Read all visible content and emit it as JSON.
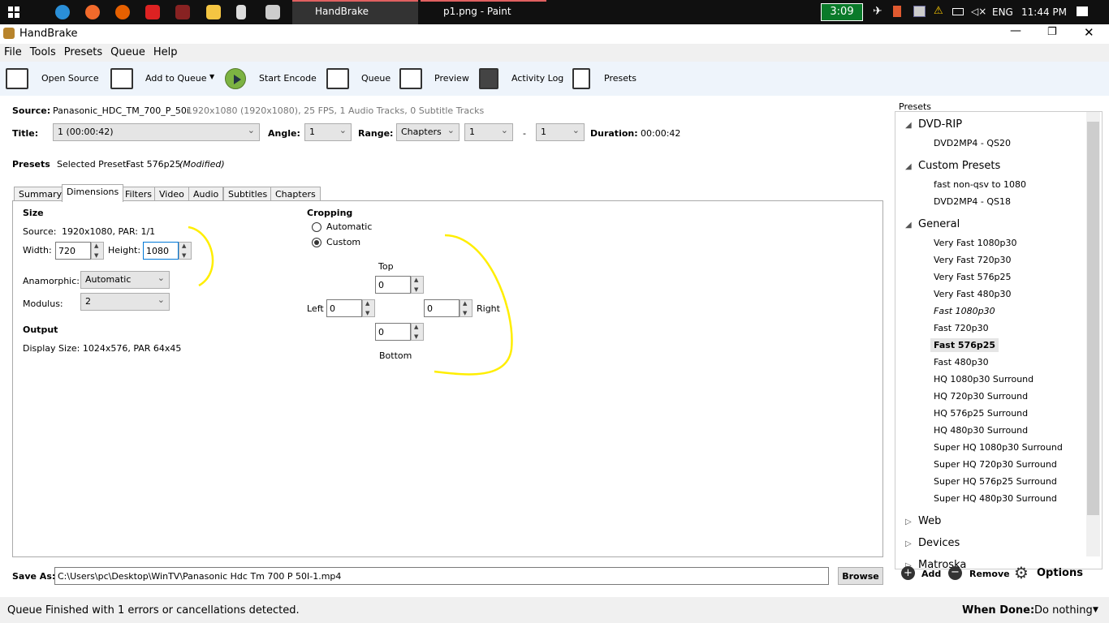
{
  "taskbar": {
    "tasks": [
      "HandBrake",
      "p1.png - Paint"
    ],
    "battery_timer": "3:09",
    "language": "ENG",
    "clock": "11:44 PM"
  },
  "window": {
    "title": "HandBrake"
  },
  "menu": [
    "File",
    "Tools",
    "Presets",
    "Queue",
    "Help"
  ],
  "toolbar": {
    "open_source": "Open Source",
    "add_to_queue": "Add to Queue",
    "start_encode": "Start Encode",
    "queue": "Queue",
    "preview": "Preview",
    "activity_log": "Activity Log",
    "presets": "Presets"
  },
  "source": {
    "label": "Source:",
    "name": "Panasonic_HDC_TM_700_P_50i",
    "info": "1920x1080 (1920x1080), 25 FPS, 1 Audio Tracks, 0 Subtitle Tracks"
  },
  "title_row": {
    "title_label": "Title:",
    "title_value": "1 (00:00:42)",
    "angle_label": "Angle:",
    "angle_value": "1",
    "range_label": "Range:",
    "range_value": "Chapters",
    "range_start": "1",
    "dash": "-",
    "range_end": "1",
    "duration_label": "Duration:",
    "duration_value": "00:00:42"
  },
  "preset_row": {
    "label": "Presets",
    "selected_label": "Selected Preset:",
    "selected_value": "Fast 576p25",
    "modified": "(Modified)"
  },
  "tabs": [
    "Summary",
    "Dimensions",
    "Filters",
    "Video",
    "Audio",
    "Subtitles",
    "Chapters"
  ],
  "dimensions": {
    "size_heading": "Size",
    "source_label": "Source:",
    "source_value": "1920x1080, PAR: 1/1",
    "width_label": "Width:",
    "width_value": "720",
    "height_label": "Height:",
    "height_value": "1080",
    "anamorphic_label": "Anamorphic:",
    "anamorphic_value": "Automatic",
    "modulus_label": "Modulus:",
    "modulus_value": "2",
    "output_heading": "Output",
    "display_size": "Display Size: 1024x576,  PAR 64x45"
  },
  "cropping": {
    "heading": "Cropping",
    "automatic": "Automatic",
    "custom": "Custom",
    "selected": "Custom",
    "top_label": "Top",
    "top": "0",
    "left_label": "Left",
    "left": "0",
    "right_label": "Right",
    "right": "0",
    "bottom_label": "Bottom",
    "bottom": "0"
  },
  "save": {
    "label": "Save As:",
    "path": "C:\\Users\\pc\\Desktop\\WinTV\\Panasonic Hdc Tm 700 P 50I-1.mp4",
    "browse": "Browse"
  },
  "presets_panel": {
    "heading": "Presets",
    "groups": [
      {
        "name": "DVD-RIP",
        "expanded": true,
        "items": [
          "DVD2MP4 - QS20"
        ]
      },
      {
        "name": "Custom Presets",
        "expanded": true,
        "items": [
          "fast non-qsv to 1080",
          "DVD2MP4 - QS18"
        ]
      },
      {
        "name": "General",
        "expanded": true,
        "items": [
          "Very Fast 1080p30",
          "Very Fast 720p30",
          "Very Fast 576p25",
          "Very Fast 480p30",
          "Fast 1080p30",
          "Fast 720p30",
          "Fast 576p25",
          "Fast 480p30",
          "HQ 1080p30 Surround",
          "HQ 720p30 Surround",
          "HQ 576p25 Surround",
          "HQ 480p30 Surround",
          "Super HQ 1080p30 Surround",
          "Super HQ 720p30 Surround",
          "Super HQ 576p25 Surround",
          "Super HQ 480p30 Surround"
        ]
      },
      {
        "name": "Web",
        "expanded": false,
        "items": []
      },
      {
        "name": "Devices",
        "expanded": false,
        "items": []
      },
      {
        "name": "Matroska",
        "expanded": false,
        "items": []
      }
    ],
    "selected": "Fast 576p25",
    "default_italic": "Fast 1080p30",
    "add": "Add",
    "remove": "Remove",
    "options": "Options"
  },
  "status": {
    "message": "Queue Finished with 1 errors or cancellations detected.",
    "when_done_label": "When Done:",
    "when_done_value": "Do nothing"
  },
  "colors": {
    "annotation": "#ffee00",
    "toolbar_bg": "#eef4fb",
    "play_green": "#7cb342"
  }
}
